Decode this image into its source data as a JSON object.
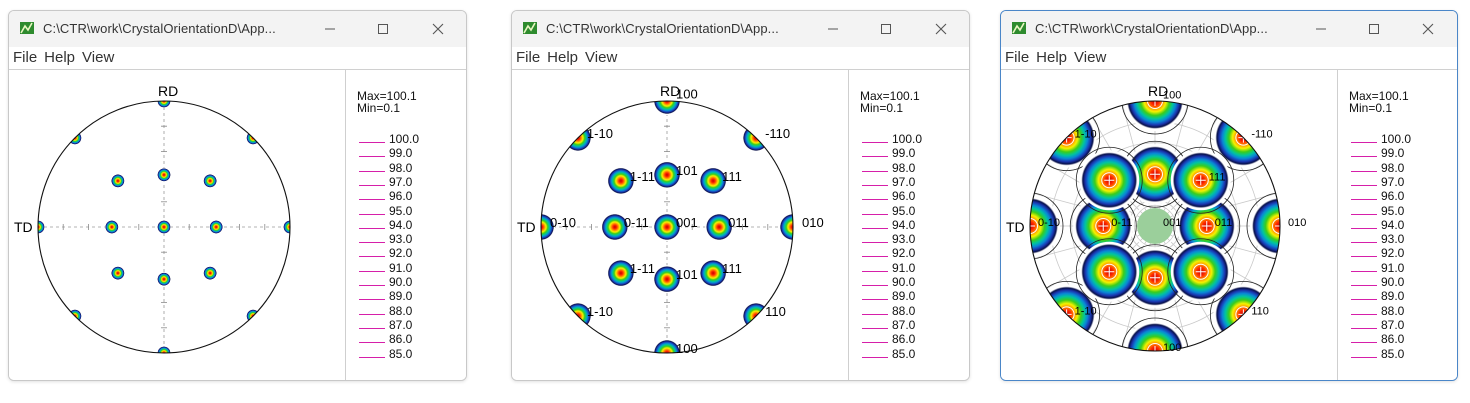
{
  "windows": [
    {
      "title": "C:\\CTR\\work\\CrystalOrientationD\\App...",
      "menu": [
        "File",
        "Help",
        "View"
      ],
      "legend": {
        "max_label": "Max=100.1",
        "min_label": "Min=0.1",
        "levels": [
          "100.0",
          "99.0",
          "98.0",
          "97.0",
          "96.0",
          "95.0",
          "94.0",
          "93.0",
          "92.0",
          "91.0",
          "90.0",
          "89.0",
          "88.0",
          "87.0",
          "86.0",
          "85.0"
        ],
        "line_color": "#d61fa9"
      },
      "plot": {
        "rd_label": "RD",
        "td_label": "TD",
        "style": "sharp-poles",
        "poles": [
          {
            "u": 0,
            "v": 0,
            "s": "s",
            "l": ""
          },
          {
            "u": 0,
            "v": -1,
            "s": "s",
            "l": ""
          },
          {
            "u": 0,
            "v": 1,
            "s": "s",
            "l": ""
          },
          {
            "u": -1,
            "v": 0,
            "s": "s",
            "l": ""
          },
          {
            "u": 1,
            "v": 0,
            "s": "s",
            "l": ""
          },
          {
            "u": -0.707,
            "v": -0.707,
            "s": "s",
            "l": ""
          },
          {
            "u": 0.707,
            "v": -0.707,
            "s": "s",
            "l": ""
          },
          {
            "u": -0.707,
            "v": 0.707,
            "s": "s",
            "l": ""
          },
          {
            "u": 0.707,
            "v": 0.707,
            "s": "s",
            "l": ""
          },
          {
            "u": 0,
            "v": -0.414,
            "s": "s",
            "l": ""
          },
          {
            "u": 0,
            "v": 0.414,
            "s": "s",
            "l": ""
          },
          {
            "u": -0.414,
            "v": 0,
            "s": "s",
            "l": ""
          },
          {
            "u": 0.414,
            "v": 0,
            "s": "s",
            "l": ""
          },
          {
            "u": -0.366,
            "v": -0.366,
            "s": "s",
            "l": ""
          },
          {
            "u": 0.366,
            "v": -0.366,
            "s": "s",
            "l": ""
          },
          {
            "u": -0.366,
            "v": 0.366,
            "s": "s",
            "l": ""
          },
          {
            "u": 0.366,
            "v": 0.366,
            "s": "s",
            "l": ""
          }
        ]
      }
    },
    {
      "title": "C:\\CTR\\work\\CrystalOrientationD\\App...",
      "menu": [
        "File",
        "Help",
        "View"
      ],
      "legend": {
        "max_label": "Max=100.1",
        "min_label": "Min=0.1",
        "levels": [
          "100.0",
          "99.0",
          "98.0",
          "97.0",
          "96.0",
          "95.0",
          "94.0",
          "93.0",
          "92.0",
          "91.0",
          "90.0",
          "89.0",
          "88.0",
          "87.0",
          "86.0",
          "85.0"
        ],
        "line_color": "#d61fa9"
      },
      "plot": {
        "rd_label": "RD",
        "td_label": "TD",
        "style": "medium-poles",
        "poles": [
          {
            "u": 0,
            "v": 0,
            "s": "m",
            "l": "001"
          },
          {
            "u": 0,
            "v": -1,
            "s": "m",
            "l": "100"
          },
          {
            "u": 0,
            "v": 1,
            "s": "m",
            "l": "100"
          },
          {
            "u": -1,
            "v": 0,
            "s": "m",
            "l": "0-10"
          },
          {
            "u": 1,
            "v": 0,
            "s": "m",
            "l": "010"
          },
          {
            "u": -0.707,
            "v": -0.707,
            "s": "m",
            "l": "1-10"
          },
          {
            "u": 0.707,
            "v": -0.707,
            "s": "m",
            "l": "-110"
          },
          {
            "u": -0.707,
            "v": 0.707,
            "s": "m",
            "l": "1-10"
          },
          {
            "u": 0.707,
            "v": 0.707,
            "s": "m",
            "l": "110"
          },
          {
            "u": 0,
            "v": -0.414,
            "s": "m",
            "l": "101"
          },
          {
            "u": 0,
            "v": 0.414,
            "s": "m",
            "l": "101"
          },
          {
            "u": -0.414,
            "v": 0,
            "s": "m",
            "l": "0-11"
          },
          {
            "u": 0.414,
            "v": 0,
            "s": "m",
            "l": "011"
          },
          {
            "u": -0.366,
            "v": -0.366,
            "s": "m",
            "l": "1-11"
          },
          {
            "u": 0.366,
            "v": -0.366,
            "s": "m",
            "l": "111"
          },
          {
            "u": -0.366,
            "v": 0.366,
            "s": "m",
            "l": "1-11"
          },
          {
            "u": 0.366,
            "v": 0.366,
            "s": "m",
            "l": "111"
          }
        ]
      }
    },
    {
      "title": "C:\\CTR\\work\\CrystalOrientationD\\App...",
      "menu": [
        "File",
        "Help",
        "View"
      ],
      "legend": {
        "max_label": "Max=100.1",
        "min_label": "Min=0.1",
        "levels": [
          "100.0",
          "99.0",
          "98.0",
          "97.0",
          "96.0",
          "95.0",
          "94.0",
          "93.0",
          "92.0",
          "91.0",
          "90.0",
          "89.0",
          "88.0",
          "87.0",
          "86.0",
          "85.0"
        ],
        "line_color": "#d61fa9"
      },
      "plot": {
        "rd_label": "RD",
        "td_label": "TD",
        "style": "broad-poles",
        "poles": [
          {
            "u": 0,
            "v": 0,
            "s": "c",
            "l": "001"
          },
          {
            "u": 0,
            "v": -1,
            "s": "l",
            "l": "100"
          },
          {
            "u": 0,
            "v": 1,
            "s": "l",
            "l": "100"
          },
          {
            "u": -1,
            "v": 0,
            "s": "l",
            "l": "0-10"
          },
          {
            "u": 1,
            "v": 0,
            "s": "l",
            "l": "010"
          },
          {
            "u": -0.707,
            "v": -0.707,
            "s": "l",
            "l": "1-10"
          },
          {
            "u": 0.707,
            "v": -0.707,
            "s": "l",
            "l": "-110"
          },
          {
            "u": -0.707,
            "v": 0.707,
            "s": "l",
            "l": "1-10"
          },
          {
            "u": 0.707,
            "v": 0.707,
            "s": "l",
            "l": "110"
          },
          {
            "u": 0,
            "v": -0.414,
            "s": "l",
            "l": ""
          },
          {
            "u": 0,
            "v": 0.414,
            "s": "l",
            "l": ""
          },
          {
            "u": -0.414,
            "v": 0,
            "s": "l",
            "l": "0-11"
          },
          {
            "u": 0.414,
            "v": 0,
            "s": "l",
            "l": "011"
          },
          {
            "u": -0.366,
            "v": -0.366,
            "s": "l",
            "l": ""
          },
          {
            "u": 0.366,
            "v": -0.366,
            "s": "l",
            "l": "111"
          },
          {
            "u": -0.366,
            "v": 0.366,
            "s": "l",
            "l": ""
          },
          {
            "u": 0.366,
            "v": 0.366,
            "s": "l",
            "l": ""
          }
        ]
      }
    }
  ]
}
